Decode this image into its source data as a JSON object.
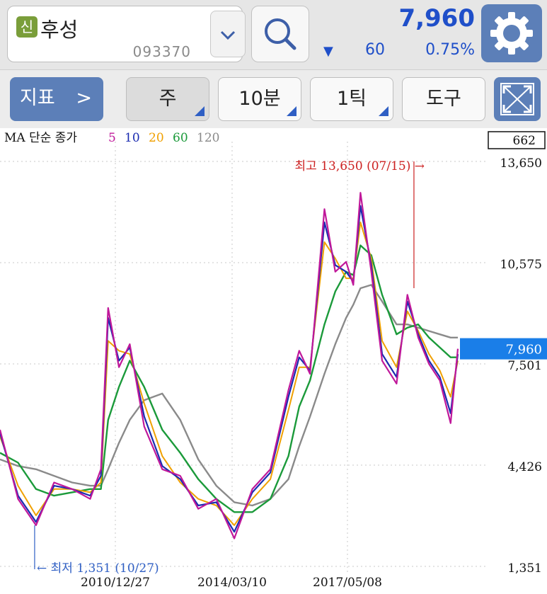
{
  "stock": {
    "badge": "신",
    "name": "후성",
    "code": "093370",
    "price": "7,960",
    "change_arrow": "▼",
    "change": "60",
    "change_pct": "0.75%"
  },
  "toolbar": {
    "indicator_label": "지표",
    "indicator_chevron": ">",
    "period_label": "주",
    "minute_label": "10분",
    "tick_label": "1틱",
    "tools_label": "도구"
  },
  "icons": {
    "badge": "shin-badge-icon",
    "dropdown": "chevron-down-icon",
    "search": "search-icon",
    "settings": "gear-icon",
    "chevron": "chevron-right-icon",
    "fullscreen": "expand-icon"
  },
  "colors": {
    "price_blue": "#1f4fc9",
    "button_blue": "#5c7fb8",
    "ma5": "#c0189a",
    "ma10": "#1a2bb0",
    "ma20": "#f0a000",
    "ma60": "#1b9a3a",
    "ma120": "#8a8a8a",
    "high": "#cc2020",
    "low": "#2f5fc4",
    "current_tag": "#1a7ee8"
  },
  "chart_data": {
    "type": "line",
    "legend": {
      "title": "MA 단순 종가",
      "periods": [
        "5",
        "10",
        "20",
        "60",
        "120"
      ]
    },
    "top_box": "662",
    "y_ticks": [
      "13,650",
      "10,575",
      "7,501",
      "4,426",
      "1,351"
    ],
    "ylim": [
      1351,
      13650
    ],
    "x_ticks": [
      "2010/12/27",
      "2014/03/10",
      "2017/05/08"
    ],
    "current_label": "7,960",
    "current_value": 7960,
    "high_label": "최고 13,650 (07/15) →",
    "high_value": 13650,
    "low_label": "← 최저 1,351 (10/27)",
    "low_value": 1351,
    "x": [
      2008.0,
      2008.5,
      2009.0,
      2009.5,
      2010.0,
      2010.5,
      2010.8,
      2011.0,
      2011.3,
      2011.6,
      2012.0,
      2012.5,
      2013.0,
      2013.5,
      2014.0,
      2014.5,
      2015.0,
      2015.5,
      2016.0,
      2016.3,
      2016.6,
      2017.0,
      2017.3,
      2017.6,
      2017.8,
      2018.0,
      2018.3,
      2018.6,
      2019.0,
      2019.3,
      2019.6,
      2019.9,
      2020.2,
      2020.5,
      2020.7
    ],
    "series": [
      {
        "name": "5",
        "values": [
          5500,
          3400,
          2600,
          3900,
          3700,
          3400,
          4300,
          9200,
          7400,
          8100,
          5600,
          4300,
          4100,
          3100,
          3400,
          2200,
          3700,
          4300,
          6700,
          7900,
          7200,
          12200,
          10300,
          10600,
          9900,
          12700,
          10300,
          7600,
          6900,
          9600,
          8300,
          7500,
          7000,
          5700,
          7960
        ]
      },
      {
        "name": "10",
        "values": [
          5400,
          3500,
          2700,
          3800,
          3700,
          3500,
          4100,
          8900,
          7600,
          8000,
          5900,
          4400,
          4000,
          3200,
          3300,
          2400,
          3600,
          4200,
          6500,
          7700,
          7300,
          11800,
          10500,
          10300,
          10000,
          12300,
          10500,
          7800,
          7100,
          9400,
          8400,
          7600,
          7100,
          6000,
          7800
        ]
      },
      {
        "name": "20",
        "values": [
          5300,
          3800,
          2900,
          3700,
          3700,
          3600,
          3900,
          8200,
          7900,
          7800,
          6300,
          4700,
          3900,
          3400,
          3200,
          2600,
          3400,
          4000,
          6100,
          7400,
          7400,
          11200,
          10700,
          10100,
          10100,
          11800,
          10700,
          8200,
          7400,
          9100,
          8500,
          7800,
          7300,
          6500,
          7600
        ]
      },
      {
        "name": "60",
        "values": [
          4800,
          4500,
          3700,
          3500,
          3600,
          3700,
          3700,
          5800,
          6800,
          7600,
          6800,
          5500,
          4800,
          4000,
          3400,
          3000,
          3000,
          3400,
          4700,
          6200,
          7000,
          8700,
          9700,
          10300,
          10200,
          11100,
          10800,
          9600,
          8400,
          8600,
          8700,
          8300,
          8000,
          7700,
          7700
        ]
      },
      {
        "name": "120",
        "values": [
          4600,
          4400,
          4300,
          4100,
          3900,
          3800,
          3800,
          4300,
          5100,
          5800,
          6400,
          6600,
          5800,
          4600,
          3800,
          3300,
          3200,
          3400,
          4000,
          5000,
          5900,
          7200,
          8100,
          8900,
          9300,
          9800,
          9900,
          9400,
          8700,
          8700,
          8600,
          8500,
          8400,
          8300,
          8300
        ]
      }
    ],
    "grid": "dotted",
    "legend_position": "top-left"
  }
}
